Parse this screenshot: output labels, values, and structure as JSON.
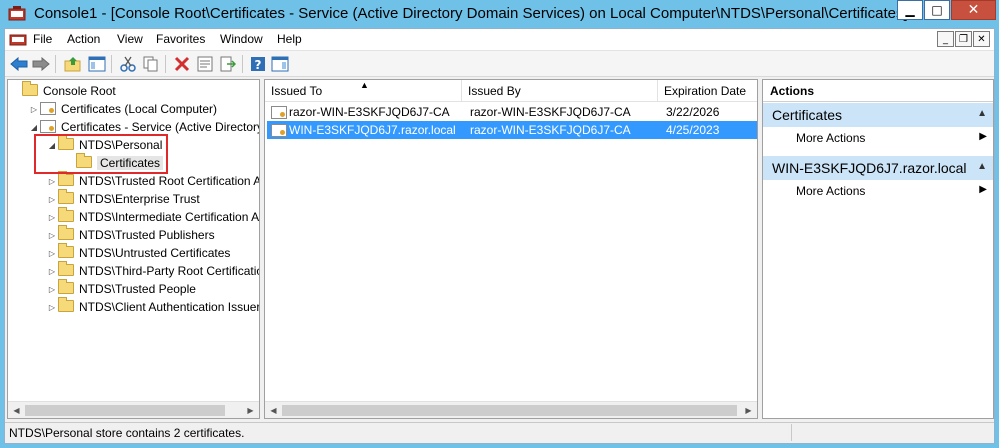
{
  "window": {
    "title": "Console1 - [Console Root\\Certificates - Service (Active Directory Domain Services) on Local Computer\\NTDS\\Personal\\Certificates]",
    "min_label": "▁",
    "max_label": "□",
    "close_label": "✕"
  },
  "menu": {
    "items": [
      "File",
      "Action",
      "View",
      "Favorites",
      "Window",
      "Help"
    ],
    "mdi_min": "_",
    "mdi_restore": "❐",
    "mdi_close": "✕"
  },
  "tree": {
    "items": [
      {
        "label": "Console Root",
        "arrow": "",
        "icon": "folder"
      },
      {
        "label": "Certificates (Local Computer)",
        "arrow": "▷",
        "icon": "cert"
      },
      {
        "label": "Certificates - Service (Active Directory D",
        "arrow": "◢",
        "icon": "cert"
      },
      {
        "label": "NTDS\\Personal",
        "arrow": "◢",
        "icon": "folder"
      },
      {
        "label": "Certificates",
        "arrow": "",
        "icon": "folder"
      },
      {
        "label": "NTDS\\Trusted Root Certification Au",
        "arrow": "▷",
        "icon": "folder"
      },
      {
        "label": "NTDS\\Enterprise Trust",
        "arrow": "▷",
        "icon": "folder"
      },
      {
        "label": "NTDS\\Intermediate Certification Au",
        "arrow": "▷",
        "icon": "folder"
      },
      {
        "label": "NTDS\\Trusted Publishers",
        "arrow": "▷",
        "icon": "folder"
      },
      {
        "label": "NTDS\\Untrusted Certificates",
        "arrow": "▷",
        "icon": "folder"
      },
      {
        "label": "NTDS\\Third-Party Root Certification",
        "arrow": "▷",
        "icon": "folder"
      },
      {
        "label": "NTDS\\Trusted People",
        "arrow": "▷",
        "icon": "folder"
      },
      {
        "label": "NTDS\\Client Authentication Issuers",
        "arrow": "▷",
        "icon": "folder"
      }
    ]
  },
  "list": {
    "columns": [
      "Issued To",
      "Issued By",
      "Expiration Date"
    ],
    "rows": [
      {
        "issued_to": "razor-WIN-E3SKFJQD6J7-CA",
        "issued_by": "razor-WIN-E3SKFJQD6J7-CA",
        "expiration": "3/22/2026",
        "selected": false
      },
      {
        "issued_to": "WIN-E3SKFJQD6J7.razor.local",
        "issued_by": "razor-WIN-E3SKFJQD6J7-CA",
        "expiration": "4/25/2023",
        "selected": true
      }
    ]
  },
  "actions": {
    "title": "Actions",
    "groups": [
      {
        "label": "Certificates",
        "items": [
          "More Actions"
        ]
      },
      {
        "label": "WIN-E3SKFJQD6J7.razor.local",
        "items": [
          "More Actions"
        ]
      }
    ]
  },
  "status": {
    "text": "NTDS\\Personal store contains 2 certificates."
  },
  "colors": {
    "titlebar": "#6fc1e8",
    "selection": "#3399ff",
    "action_group": "#cce4f7",
    "highlight_box": "#e0292a"
  }
}
